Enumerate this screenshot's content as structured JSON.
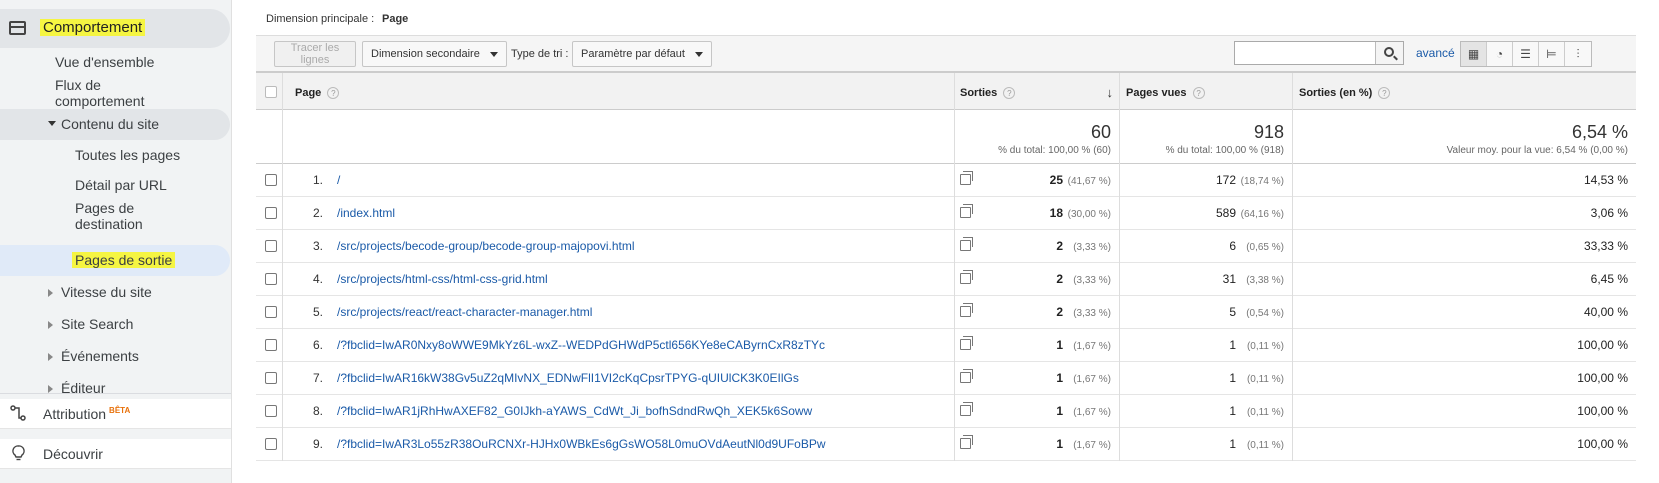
{
  "sidebar": {
    "header": "Comportement",
    "items": [
      {
        "label": "Vue d'ensemble"
      },
      {
        "label": "Flux de comportement"
      }
    ],
    "groups": [
      {
        "label": "Contenu du site",
        "expanded": true
      },
      {
        "label": "Vitesse du site"
      },
      {
        "label": "Site Search"
      },
      {
        "label": "Événements"
      },
      {
        "label": "Éditeur"
      }
    ],
    "subitems": [
      {
        "label": "Toutes les pages"
      },
      {
        "label": "Détail par URL"
      },
      {
        "label": "Pages de destination"
      },
      {
        "label": "Pages de sortie",
        "active": true
      }
    ],
    "bottom": [
      {
        "label": "Attribution",
        "badge": "BÊTA",
        "icon": "attribution-icon"
      },
      {
        "label": "Découvrir",
        "icon": "lightbulb-icon"
      }
    ]
  },
  "dimension": {
    "label": "Dimension principale :",
    "value": "Page"
  },
  "toolbar": {
    "plot_rows": "Tracer les lignes",
    "secondary_dimension": "Dimension secondaire",
    "sort_label": "Type de tri :",
    "sort_value": "Paramètre par défaut",
    "search_placeholder": "",
    "advanced": "avancé"
  },
  "table": {
    "columns": {
      "page": "Page",
      "exits": "Sorties",
      "pageviews": "Pages vues",
      "exit_rate": "Sorties (en %)"
    },
    "totals": {
      "exits": "60",
      "exits_sub": "% du total: 100,00 % (60)",
      "pageviews": "918",
      "pageviews_sub": "% du total: 100,00 % (918)",
      "exit_rate": "6,54 %",
      "exit_rate_sub": "Valeur moy. pour la vue: 6,54 % (0,00 %)"
    },
    "rows": [
      {
        "idx": "1.",
        "page": "/",
        "exits": "25",
        "exits_pct": "(41,67 %)",
        "views": "172",
        "views_pct": "(18,74 %)",
        "rate": "14,53 %"
      },
      {
        "idx": "2.",
        "page": "/index.html",
        "exits": "18",
        "exits_pct": "(30,00 %)",
        "views": "589",
        "views_pct": "(64,16 %)",
        "rate": "3,06 %"
      },
      {
        "idx": "3.",
        "page": "/src/projects/becode-group/becode-group-majopovi.html",
        "exits": "2",
        "exits_pct": "(3,33 %)",
        "views": "6",
        "views_pct": "(0,65 %)",
        "rate": "33,33 %"
      },
      {
        "idx": "4.",
        "page": "/src/projects/html-css/html-css-grid.html",
        "exits": "2",
        "exits_pct": "(3,33 %)",
        "views": "31",
        "views_pct": "(3,38 %)",
        "rate": "6,45 %"
      },
      {
        "idx": "5.",
        "page": "/src/projects/react/react-character-manager.html",
        "exits": "2",
        "exits_pct": "(3,33 %)",
        "views": "5",
        "views_pct": "(0,54 %)",
        "rate": "40,00 %"
      },
      {
        "idx": "6.",
        "page": "/?fbclid=IwAR0Nxy8oWWE9MkYz6L-wxZ--WEDPdGHWdP5ctl656KYe8eCAByrnCxR8zTYc",
        "exits": "1",
        "exits_pct": "(1,67 %)",
        "views": "1",
        "views_pct": "(0,11 %)",
        "rate": "100,00 %"
      },
      {
        "idx": "7.",
        "page": "/?fbclid=IwAR16kW38Gv5uZ2qMIvNX_EDNwFlI1VI2cKqCpsrTPYG-qUIUlCK3K0EIlGs",
        "exits": "1",
        "exits_pct": "(1,67 %)",
        "views": "1",
        "views_pct": "(0,11 %)",
        "rate": "100,00 %"
      },
      {
        "idx": "8.",
        "page": "/?fbclid=IwAR1jRhHwAXEF82_G0IJkh-aYAWS_CdWt_Ji_bofhSdndRwQh_XEK5k6Soww",
        "exits": "1",
        "exits_pct": "(1,67 %)",
        "views": "1",
        "views_pct": "(0,11 %)",
        "rate": "100,00 %"
      },
      {
        "idx": "9.",
        "page": "/?fbclid=IwAR3Lo55zR38OuRCNXr-HJHx0WBkEs6gGsWO58L0muOVdAeutNl0d9UFoBPw",
        "exits": "1",
        "exits_pct": "(1,67 %)",
        "views": "1",
        "views_pct": "(0,11 %)",
        "rate": "100,00 %"
      }
    ]
  },
  "colors": {
    "highlight": "#f5f542",
    "link": "#1a5aa8",
    "beta": "#e8710a"
  }
}
